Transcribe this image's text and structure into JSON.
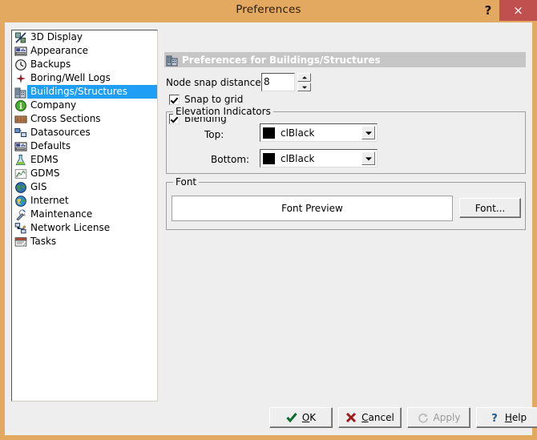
{
  "window": {
    "title": "Preferences",
    "help_glyph": "?",
    "close_glyph": "×",
    "frame_color": "#e3a961",
    "close_color": "#c0504d"
  },
  "sidebar": {
    "selected": "Buildings/Structures",
    "selection_color": "#1e9ef5",
    "items": [
      {
        "label": "3D Display",
        "icon": "3d-display-icon"
      },
      {
        "label": "Appearance",
        "icon": "appearance-icon"
      },
      {
        "label": "Backups",
        "icon": "clock-icon"
      },
      {
        "label": "Boring/Well Logs",
        "icon": "boring-well-logs-icon"
      },
      {
        "label": "Buildings/Structures",
        "icon": "buildings-icon"
      },
      {
        "label": "Company",
        "icon": "company-info-icon"
      },
      {
        "label": "Cross Sections",
        "icon": "cross-sections-icon"
      },
      {
        "label": "Datasources",
        "icon": "datasources-icon"
      },
      {
        "label": "Defaults",
        "icon": "defaults-icon"
      },
      {
        "label": "EDMS",
        "icon": "flask-icon"
      },
      {
        "label": "GDMS",
        "icon": "gdms-chart-icon"
      },
      {
        "label": "GIS",
        "icon": "globe-icon"
      },
      {
        "label": "Internet",
        "icon": "internet-globe-icon"
      },
      {
        "label": "Maintenance",
        "icon": "wrench-icon"
      },
      {
        "label": "Network License",
        "icon": "network-license-icon"
      },
      {
        "label": "Tasks",
        "icon": "tasks-icon"
      }
    ]
  },
  "panel": {
    "header": "Preferences for Buildings/Structures",
    "header_icon": "buildings-icon",
    "node_snap_label": "Node snap distance:",
    "node_snap_value": "8",
    "snap_to_grid_label": "Snap to grid",
    "snap_to_grid_checked": true,
    "blending_label": "Blending",
    "blending_checked": true,
    "elevation_group": {
      "title": "Elevation Indicators",
      "top_label": "Top:",
      "top_value": "clBlack",
      "top_color": "#000000",
      "bottom_label": "Bottom:",
      "bottom_value": "clBlack",
      "bottom_color": "#000000"
    },
    "font_group": {
      "title": "Font",
      "preview_text": "Font Preview",
      "button_label": "Font..."
    }
  },
  "buttons": {
    "ok": {
      "label": "OK",
      "accel": "O",
      "icon": "check-icon",
      "enabled": true
    },
    "cancel": {
      "label": "Cancel",
      "accel": "C",
      "icon": "x-icon",
      "enabled": true
    },
    "apply": {
      "label": "Apply",
      "accel": "",
      "icon": "refresh-icon",
      "enabled": false
    },
    "help": {
      "label": "Help",
      "accel": "H",
      "icon": "question-icon",
      "enabled": true
    }
  }
}
